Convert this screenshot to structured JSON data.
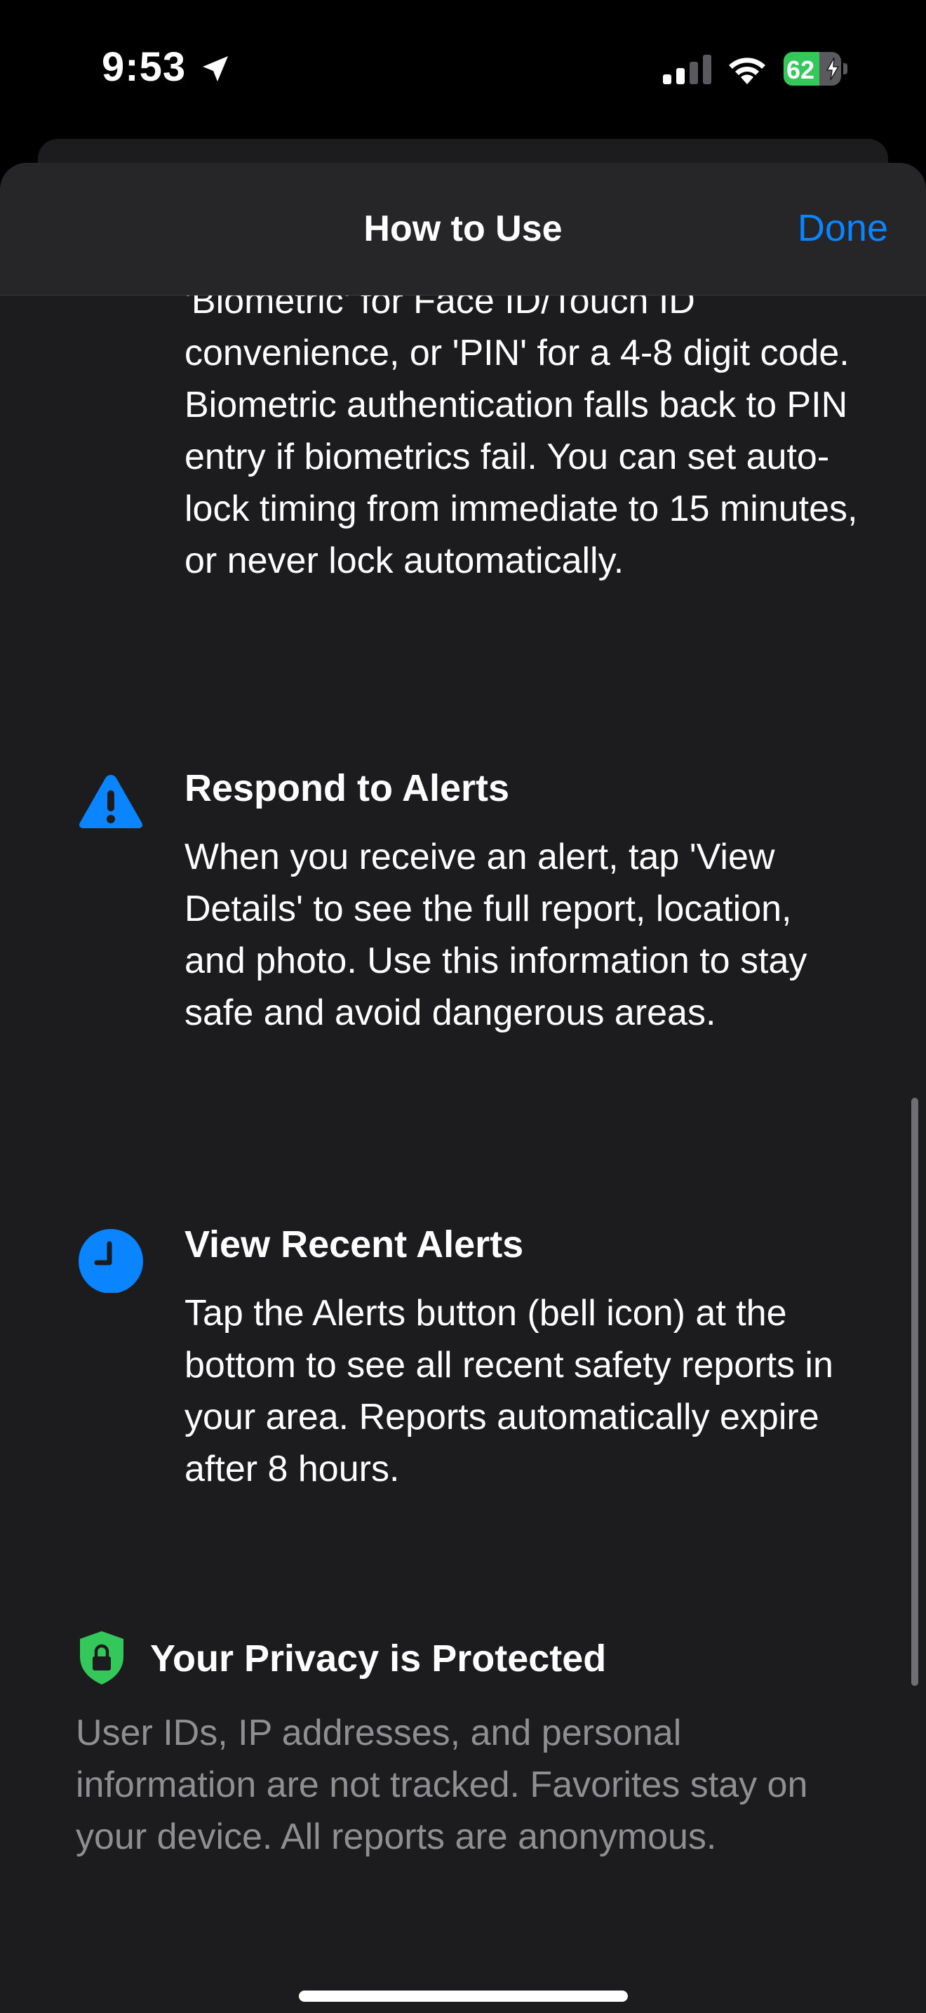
{
  "status_bar": {
    "time": "9:53",
    "battery_percent": "62",
    "battery_level": 0.62,
    "icons": [
      "location-arrow-icon",
      "cellular-signal-icon",
      "wifi-icon",
      "battery-icon",
      "charging-bolt-icon"
    ]
  },
  "sheet": {
    "title": "How to Use",
    "done_label": "Done"
  },
  "content": {
    "continued_paragraph": "'Biometric' for Face ID/Touch ID convenience, or 'PIN' for a 4-8 digit code. Biometric authentication falls back to PIN entry if biometrics fail. You can set auto-lock timing from immediate to 15 minutes, or never lock automatically.",
    "sections": [
      {
        "icon": "warning-triangle-icon",
        "title": "Respond to Alerts",
        "text": "When you receive an alert, tap 'View Details' to see the full report, location, and photo. Use this information to stay safe and avoid dangerous areas."
      },
      {
        "icon": "clock-icon",
        "title": "View Recent Alerts",
        "text": "Tap the Alerts button (bell icon) at the bottom to see all recent safety reports in your area. Reports automatically expire after 8 hours."
      }
    ],
    "privacy": {
      "icon": "shield-lock-icon",
      "title": "Your Privacy is Protected",
      "text": "User IDs, IP addresses, and personal information are not tracked. Favorites stay on your device. All reports are anonymous."
    }
  },
  "colors": {
    "accent": "#0a84ff",
    "privacy_green": "#34c759",
    "background": "#1c1c1e",
    "secondary_text": "#8e8e93"
  }
}
